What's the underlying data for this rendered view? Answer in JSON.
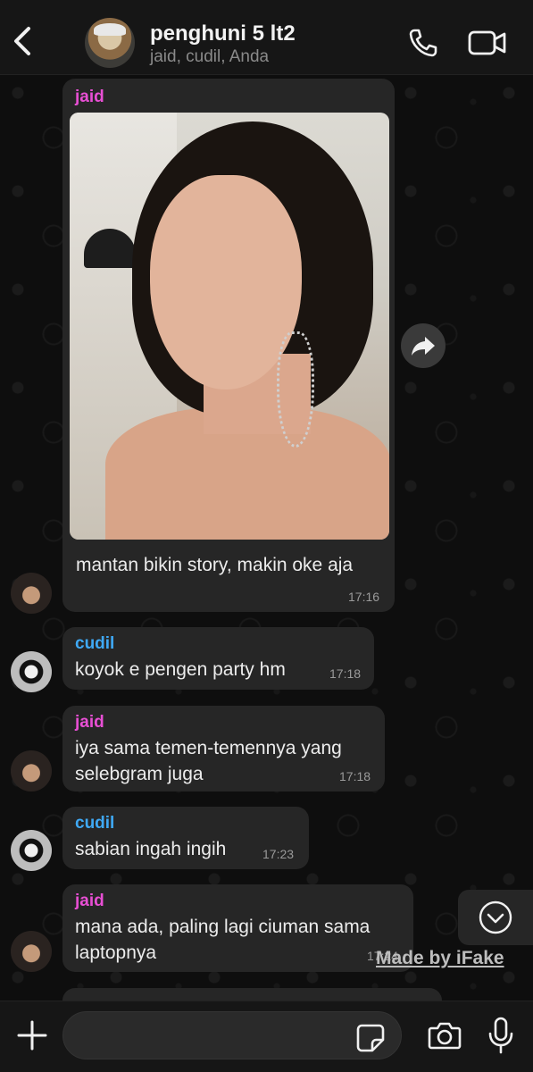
{
  "header": {
    "title": "penghuni 5 lt2",
    "subtitle": "jaid, cudil, Anda"
  },
  "messages": [
    {
      "sender": "jaid",
      "text": "mantan bikin story, makin oke aja",
      "time": "17:16",
      "has_image": true
    },
    {
      "sender": "cudil",
      "text": "koyok e pengen party hm",
      "time": "17:18"
    },
    {
      "sender": "jaid",
      "text": "iya sama temen-temennya yang selebgram juga",
      "time": "17:18"
    },
    {
      "sender": "cudil",
      "text": "sabian ingah ingih",
      "time": "17:23"
    },
    {
      "sender": "jaid",
      "text": "mana ada, paling lagi ciuman sama laptopnya",
      "time": "17:24"
    }
  ],
  "watermark": "Made by iFake",
  "colors": {
    "jaid_name": "#e84fd4",
    "cudil_name": "#3fa9f5",
    "bubble": "#262626"
  },
  "icons": [
    "back-icon",
    "phone-icon",
    "video-icon",
    "forward-icon",
    "chevron-down-icon",
    "plus-icon",
    "sticker-icon",
    "camera-icon",
    "mic-icon"
  ]
}
